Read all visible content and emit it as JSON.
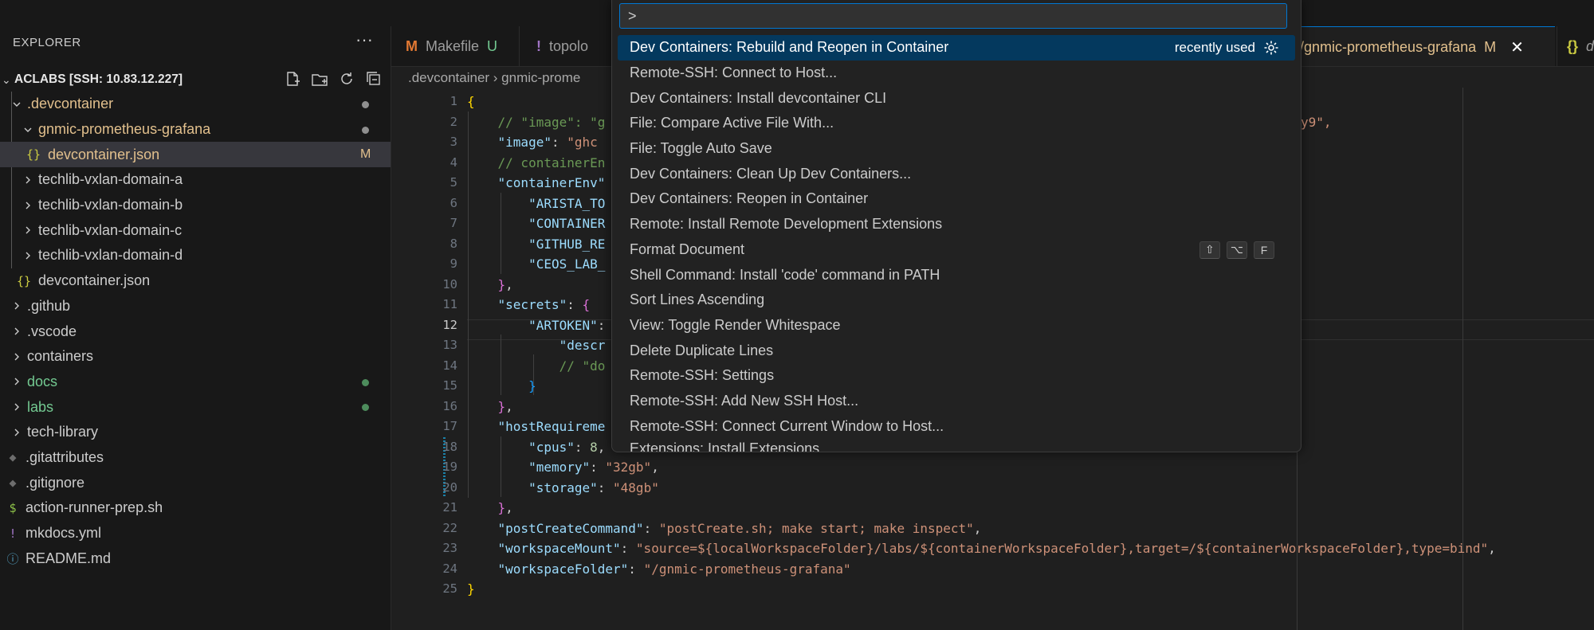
{
  "sidebar": {
    "title": "EXPLORER",
    "more_icon": "ellipsis-icon",
    "root": "ACLABS [SSH: 10.83.12.227]",
    "tree": [
      {
        "label": ".devcontainer",
        "color": "#e2c08d",
        "badge": "dot"
      },
      {
        "label": "gnmic-prometheus-grafana",
        "color": "#e2c08d",
        "badge": "dot"
      },
      {
        "label": "devcontainer.json",
        "color": "#e2c08d",
        "badge": "M"
      },
      {
        "label": "techlib-vxlan-domain-a"
      },
      {
        "label": "techlib-vxlan-domain-b"
      },
      {
        "label": "techlib-vxlan-domain-c"
      },
      {
        "label": "techlib-vxlan-domain-d"
      },
      {
        "label": "devcontainer.json"
      },
      {
        "label": ".github"
      },
      {
        "label": ".vscode"
      },
      {
        "label": "containers"
      },
      {
        "label": "docs",
        "color": "#73c991",
        "badge": "dot"
      },
      {
        "label": "labs",
        "color": "#73c991",
        "badge": "dot"
      },
      {
        "label": "tech-library"
      },
      {
        "label": ".gitattributes"
      },
      {
        "label": ".gitignore"
      },
      {
        "label": "action-runner-prep.sh"
      },
      {
        "label": "mkdocs.yml"
      },
      {
        "label": "README.md"
      }
    ]
  },
  "tabs": [
    {
      "icon": "M",
      "label": "Makefile",
      "badge": "U"
    },
    {
      "icon": "!",
      "label": "topolo"
    },
    {
      "icon": "",
      "label": "/gnmic-prometheus-grafana",
      "badge": "M"
    },
    {
      "icon": "{}",
      "label": "devc"
    }
  ],
  "breadcrumb": ".devcontainer  ›  gnmic-prome",
  "editor": {
    "line_numbers": [
      "1",
      "2",
      "3",
      "4",
      "5",
      "6",
      "7",
      "8",
      "9",
      "10",
      "11",
      "12",
      "13",
      "14",
      "15",
      "16",
      "17",
      "18",
      "19",
      "20",
      "21",
      "22",
      "23",
      "24",
      "25"
    ],
    "current_line": 12,
    "code": {
      "l2_comment": "// \"image\": \"g",
      "l2_tail": "y9\",",
      "l3_key": "\"image\"",
      "l3_val": "\"ghc",
      "l4_comment": "// containerEn",
      "l5_key": "\"containerEnv\"",
      "l6_key": "\"ARISTA_TO",
      "l7_key": "\"CONTAINER",
      "l8_key": "\"GITHUB_RE",
      "l9_key": "\"CEOS_LAB_",
      "l11_key": "\"secrets\"",
      "l12_key": "\"ARTOKEN\"",
      "l13_key": "\"descr",
      "l14_comment": "// \"do",
      "l17_key": "\"hostRequireme",
      "l18_key": "\"cpus\"",
      "l18_val": "8",
      "l19_key": "\"memory\"",
      "l19_val": "\"32gb\"",
      "l20_key": "\"storage\"",
      "l20_val": "\"48gb\"",
      "l22_key": "\"postCreateCommand\"",
      "l22_val": "\"postCreate.sh; make start; make inspect\"",
      "l23_key": "\"workspaceMount\"",
      "l23_val": "\"source=${localWorkspaceFolder}/labs/${containerWorkspaceFolder},target=/${containerWorkspaceFolder},type=bind\"",
      "l24_key": "\"workspaceFolder\"",
      "l24_val": "\"/gnmic-prometheus-grafana\""
    }
  },
  "palette": {
    "input_value": ">",
    "items": [
      {
        "label": "Dev Containers: Rebuild and Reopen in Container",
        "meta": "recently used",
        "meta_icon": "gear-icon"
      },
      {
        "label": "Remote-SSH: Connect to Host..."
      },
      {
        "label": "Dev Containers: Install devcontainer CLI"
      },
      {
        "label": "File: Compare Active File With..."
      },
      {
        "label": "File: Toggle Auto Save"
      },
      {
        "label": "Dev Containers: Clean Up Dev Containers..."
      },
      {
        "label": "Dev Containers: Reopen in Container"
      },
      {
        "label": "Remote: Install Remote Development Extensions"
      },
      {
        "label": "Format Document",
        "keys": [
          "⇧",
          "⌥",
          "F"
        ]
      },
      {
        "label": "Shell Command: Install 'code' command in PATH"
      },
      {
        "label": "Sort Lines Ascending"
      },
      {
        "label": "View: Toggle Render Whitespace"
      },
      {
        "label": "Delete Duplicate Lines"
      },
      {
        "label": "Remote-SSH: Settings"
      },
      {
        "label": "Remote-SSH: Add New SSH Host..."
      },
      {
        "label": "Remote-SSH: Connect Current Window to Host..."
      },
      {
        "label": "Extensions: Install Extensions"
      }
    ]
  },
  "colors": {
    "accent": "#0078d4",
    "selection": "#04395e",
    "modified": "#e2c08d",
    "untracked": "#73c991"
  }
}
